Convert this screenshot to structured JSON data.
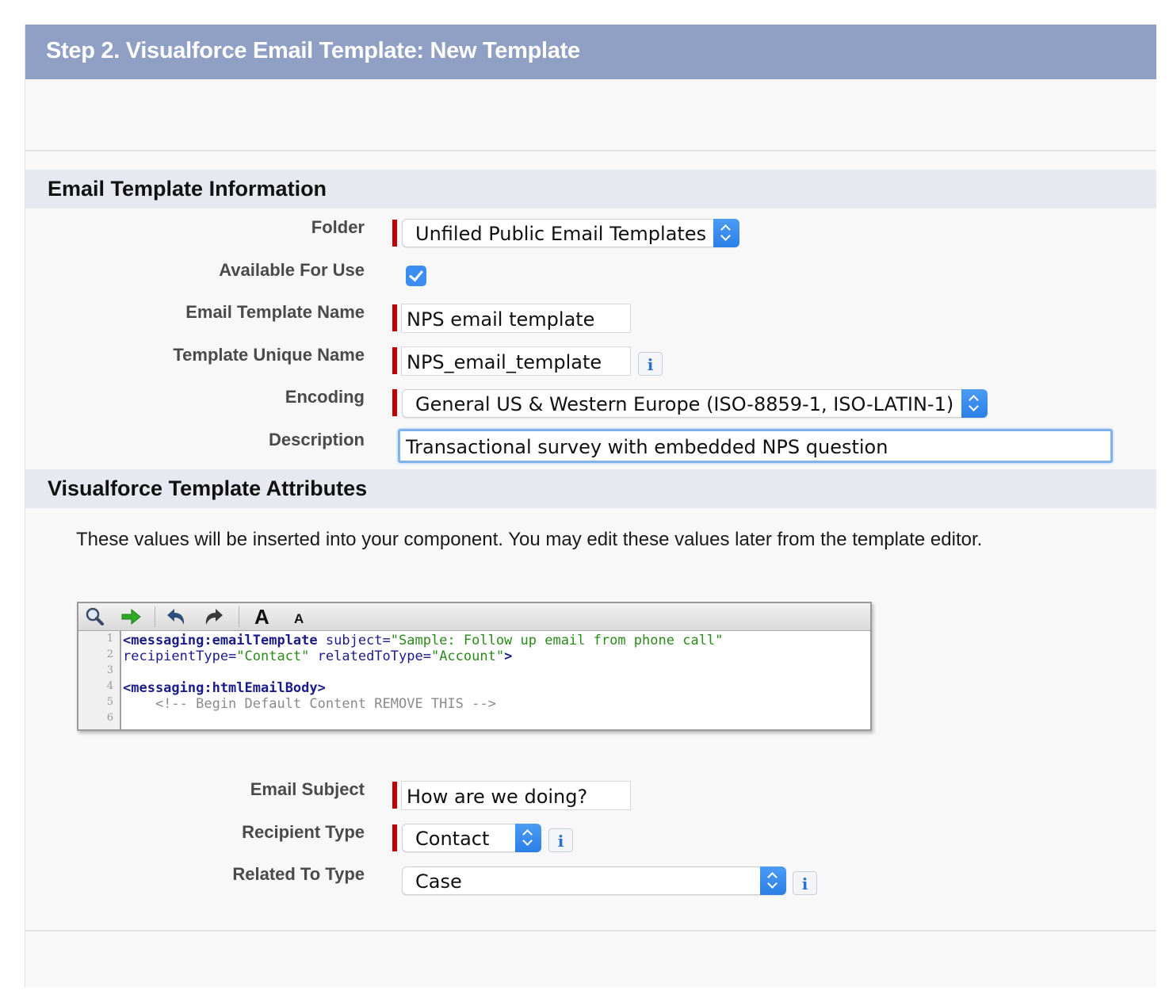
{
  "step_title": "Step 2. Visualforce Email Template: New Template",
  "sections": {
    "info_title": "Email Template Information",
    "attributes_title": "Visualforce Template Attributes"
  },
  "fields": {
    "folder": {
      "label": "Folder",
      "value": "Unfiled Public Email Templates"
    },
    "available": {
      "label": "Available For Use",
      "checked": true
    },
    "template_name": {
      "label": "Email Template Name",
      "value": "NPS email template"
    },
    "unique_name": {
      "label": "Template Unique Name",
      "value": "NPS_email_template"
    },
    "encoding": {
      "label": "Encoding",
      "value": "General US & Western Europe (ISO-8859-1, ISO-LATIN-1)"
    },
    "description": {
      "label": "Description",
      "value": "Transactional survey with embedded NPS question"
    },
    "email_subject": {
      "label": "Email Subject",
      "value": "How are we doing?"
    },
    "recipient_type": {
      "label": "Recipient Type",
      "value": "Contact"
    },
    "related_to_type": {
      "label": "Related To Type",
      "value": "Case"
    }
  },
  "help_text": "These values will be inserted into your component. You may edit these values later from the template editor.",
  "info_icon": "i",
  "editor": {
    "toolbar": [
      "search-icon",
      "goto-arrow-icon",
      "undo-icon",
      "redo-icon",
      "font-larger-icon",
      "font-smaller-icon"
    ],
    "font_large_glyph": "A",
    "font_small_glyph": "A",
    "line_numbers": [
      "1",
      "2",
      "3",
      "4",
      "5",
      "6"
    ],
    "code": {
      "l1_tag": "<messaging:emailTemplate",
      "l1_attr": " subject=",
      "l1_val": "\"Sample: Follow up email from phone call\"",
      "l2_attr": "recipientType=",
      "l2_val": "\"Contact\"",
      "l2_attr2": " relatedToType=",
      "l2_val2": "\"Account\"",
      "l2_end": ">",
      "l4_tag": "<messaging:htmlEmailBody>",
      "l5_comment": "    <!-- Begin Default Content REMOVE THIS -->"
    }
  },
  "colors": {
    "title_bar": "#8fa0c4",
    "section_header": "#e6e9f0",
    "required_marker": "#c00000",
    "select_arrows": "#3b8df0"
  }
}
